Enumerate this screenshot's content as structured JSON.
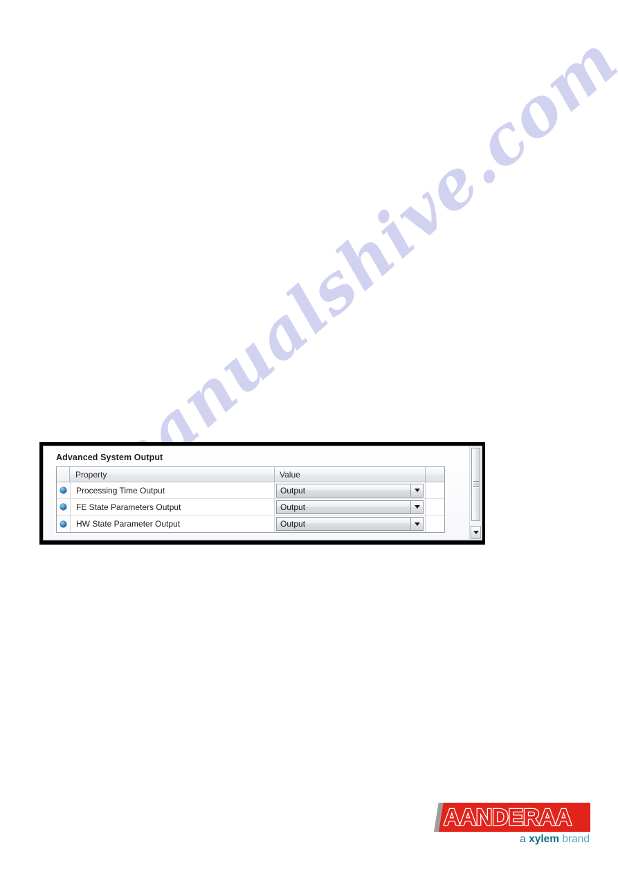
{
  "watermark": {
    "text": "manualshive.com",
    "color": "#cdcdef"
  },
  "panel": {
    "title": "Advanced System Output",
    "grid": {
      "columns": [
        {
          "key": "gutter",
          "label": ""
        },
        {
          "key": "property",
          "label": "Property"
        },
        {
          "key": "value",
          "label": "Value"
        }
      ],
      "rows": [
        {
          "icon": "blue-sphere-icon",
          "property": "Processing Time Output",
          "value": "Output",
          "control": "dropdown"
        },
        {
          "icon": "blue-sphere-icon",
          "property": "FE State Parameters Output",
          "value": "Output",
          "control": "dropdown"
        },
        {
          "icon": "blue-sphere-icon",
          "property": "HW State Parameter Output",
          "value": "Output",
          "control": "dropdown"
        }
      ]
    },
    "scrollbar": {
      "orientation": "vertical",
      "down_arrow": "chevron-down-icon"
    }
  },
  "logo": {
    "wordmark": "AANDERAA",
    "tagline_a": "a ",
    "tagline_xylem": "xylem",
    "tagline_brand": " brand",
    "red": "#e2231a",
    "teal": "#0e6f86"
  }
}
